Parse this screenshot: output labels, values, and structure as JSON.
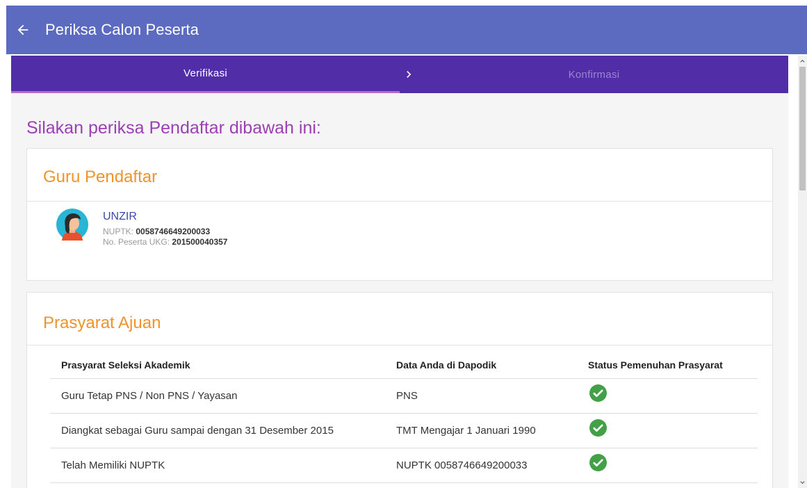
{
  "appbar": {
    "title": "Periksa Calon Peserta",
    "back_icon": "arrow-left-icon",
    "color": "#5c6bc0"
  },
  "stepper": {
    "steps": [
      {
        "label": "Verifikasi",
        "active": true
      },
      {
        "label": "Konfirmasi",
        "active": false
      }
    ],
    "separator_icon": "chevron-right-icon",
    "color": "#512da8"
  },
  "heading": "Silakan periksa Pendaftar dibawah ini:",
  "guru_card": {
    "title": "Guru Pendaftar",
    "name": "UNZIR",
    "nuptk_label": "NUPTK:",
    "nuptk_value": "0058746649200033",
    "ukg_label": "No. Peserta UKG:",
    "ukg_value": "201500040357",
    "avatar_icon": "female-avatar-icon"
  },
  "prasyarat_card": {
    "title": "Prasyarat Ajuan",
    "columns": [
      "Prasyarat Seleksi Akademik",
      "Data Anda di Dapodik",
      "Status Pemenuhan Prasyarat"
    ],
    "rows": [
      {
        "requirement": "Guru Tetap PNS / Non PNS / Yayasan",
        "data": "PNS",
        "status": "check-circle-icon"
      },
      {
        "requirement": "Diangkat sebagai Guru sampai dengan 31 Desember 2015",
        "data": "TMT Mengajar 1 Januari 1990",
        "status": "check-circle-icon"
      },
      {
        "requirement": "Telah Memiliki NUPTK",
        "data": "NUPTK 0058746649200033",
        "status": "check-circle-icon"
      }
    ]
  },
  "colors": {
    "heading": "#9c3fb5",
    "card_title": "#f0932b",
    "name": "#3949ab",
    "success": "#43a047"
  }
}
